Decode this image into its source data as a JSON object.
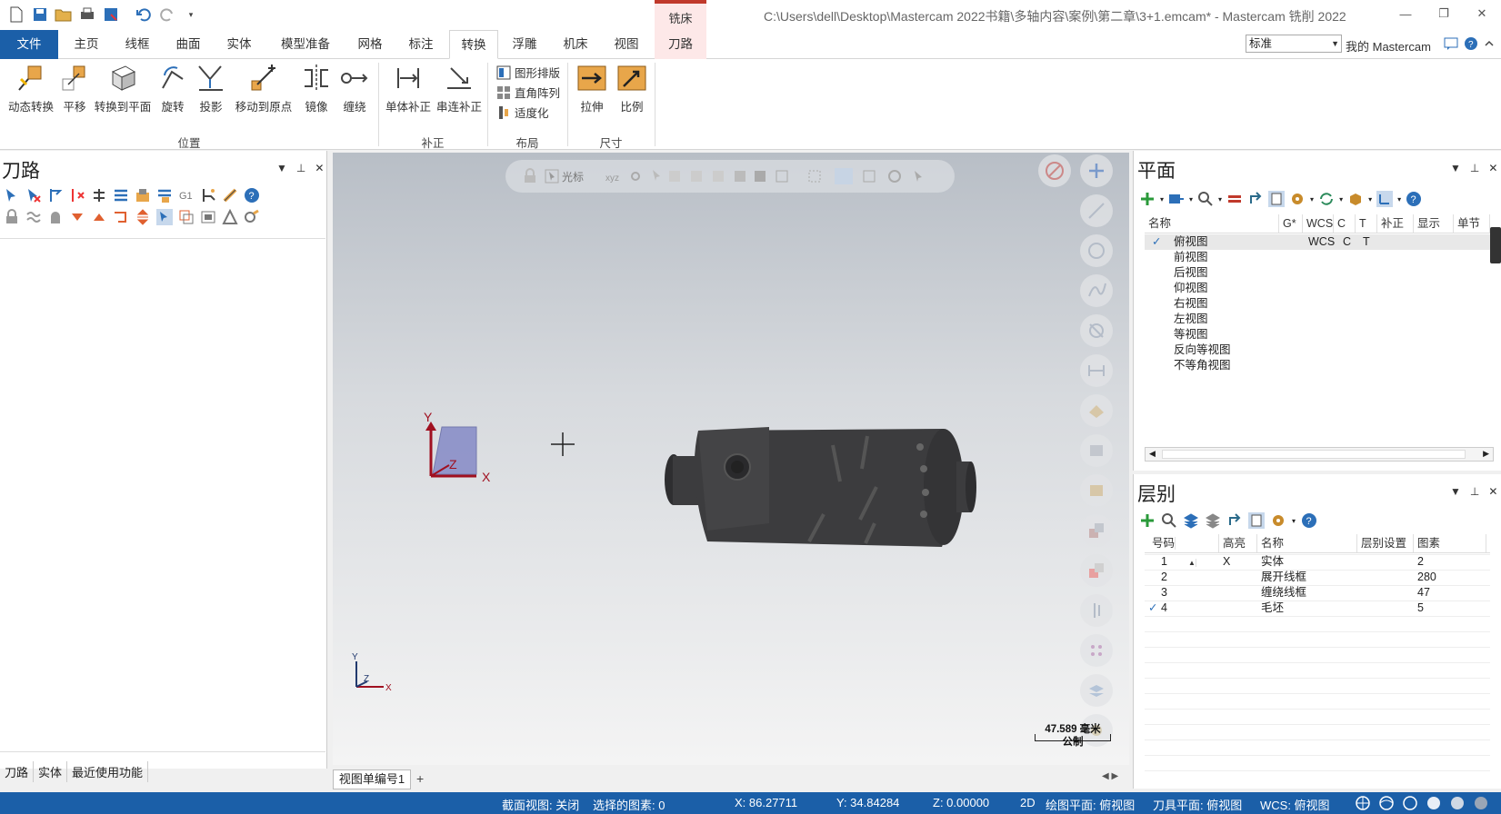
{
  "window": {
    "title": "C:\\Users\\dell\\Desktop\\Mastercam 2022书籍\\多轴内容\\案例\\第二章\\3+1.emcam* - Mastercam 铣削 2022",
    "context_tab_header": "铣床"
  },
  "tabs": [
    "文件",
    "主页",
    "线框",
    "曲面",
    "实体",
    "模型准备",
    "网格",
    "标注",
    "转换",
    "浮雕",
    "机床",
    "视图",
    "刀路"
  ],
  "active_tab": "转换",
  "config_combo": "标准",
  "my_mastercam": "我的 Mastercam",
  "ribbon": {
    "position_group": {
      "label": "位置",
      "buttons": [
        "动态转换",
        "平移",
        "转换到平面",
        "旋转",
        "投影",
        "移动到原点",
        "镜像",
        "缠绕"
      ]
    },
    "offset_group": {
      "label": "补正",
      "buttons": [
        "单体补正",
        "串连补正"
      ]
    },
    "layout_group": {
      "label": "布局",
      "buttons": [
        "图形排版",
        "直角阵列",
        "适度化"
      ]
    },
    "size_group": {
      "label": "尺寸",
      "buttons": [
        "拉伸",
        "比例"
      ]
    }
  },
  "left_panel": {
    "title": "刀路",
    "bottom_tabs": [
      "刀路",
      "实体",
      "最近使用功能"
    ]
  },
  "viewport": {
    "toolbar_cursor_label": "光标",
    "gnomon": {
      "y": "Y",
      "z": "Z",
      "x": "X"
    },
    "small_gnomon": {
      "y": "Y",
      "z": "Z",
      "x": "X"
    },
    "scale_value": "47.589 毫米",
    "scale_unit": "公制",
    "view_tab": "视图单编号1",
    "add_tab": "+"
  },
  "planes_panel": {
    "title": "平面",
    "columns": [
      "名称",
      "G*",
      "WCS",
      "C",
      "T",
      "补正",
      "显示",
      "单节"
    ],
    "rows": [
      {
        "check": "✓",
        "name": "俯视图",
        "wcs": "WCS",
        "c": "C",
        "t": "T"
      },
      {
        "check": "",
        "name": "前视图",
        "wcs": "",
        "c": "",
        "t": ""
      },
      {
        "check": "",
        "name": "后视图",
        "wcs": "",
        "c": "",
        "t": ""
      },
      {
        "check": "",
        "name": "仰视图",
        "wcs": "",
        "c": "",
        "t": ""
      },
      {
        "check": "",
        "name": "右视图",
        "wcs": "",
        "c": "",
        "t": ""
      },
      {
        "check": "",
        "name": "左视图",
        "wcs": "",
        "c": "",
        "t": ""
      },
      {
        "check": "",
        "name": "等视图",
        "wcs": "",
        "c": "",
        "t": ""
      },
      {
        "check": "",
        "name": "反向等视图",
        "wcs": "",
        "c": "",
        "t": ""
      },
      {
        "check": "",
        "name": "不等角视图",
        "wcs": "",
        "c": "",
        "t": ""
      }
    ]
  },
  "levels_panel": {
    "title": "层别",
    "columns": [
      "号码",
      "高亮",
      "名称",
      "层别设置",
      "图素"
    ],
    "rows": [
      {
        "check": "",
        "number": "1",
        "highlight": "X",
        "name": "实体",
        "count": "2"
      },
      {
        "check": "",
        "number": "2",
        "highlight": "",
        "name": "展开线框",
        "count": "280"
      },
      {
        "check": "",
        "number": "3",
        "highlight": "",
        "name": "缠绕线框",
        "count": "47"
      },
      {
        "check": "✓",
        "number": "4",
        "highlight": "",
        "name": "毛坯",
        "count": "5"
      }
    ]
  },
  "status_bar": {
    "section_view": "截面视图: 关闭",
    "selected": "选择的图素: 0",
    "x": "X:  86.27711",
    "y": "Y:  34.84284",
    "z": "Z:  0.00000",
    "mode": "2D",
    "draw_plane": "绘图平面: 俯视图",
    "tool_plane": "刀具平面: 俯视图",
    "wcs": "WCS: 俯视图"
  },
  "colors": {
    "file_tab": "#1b5fa8",
    "status_bar": "#1b5fa8",
    "context_accent": "#c0392b",
    "part_body": "#3c3c3e"
  }
}
